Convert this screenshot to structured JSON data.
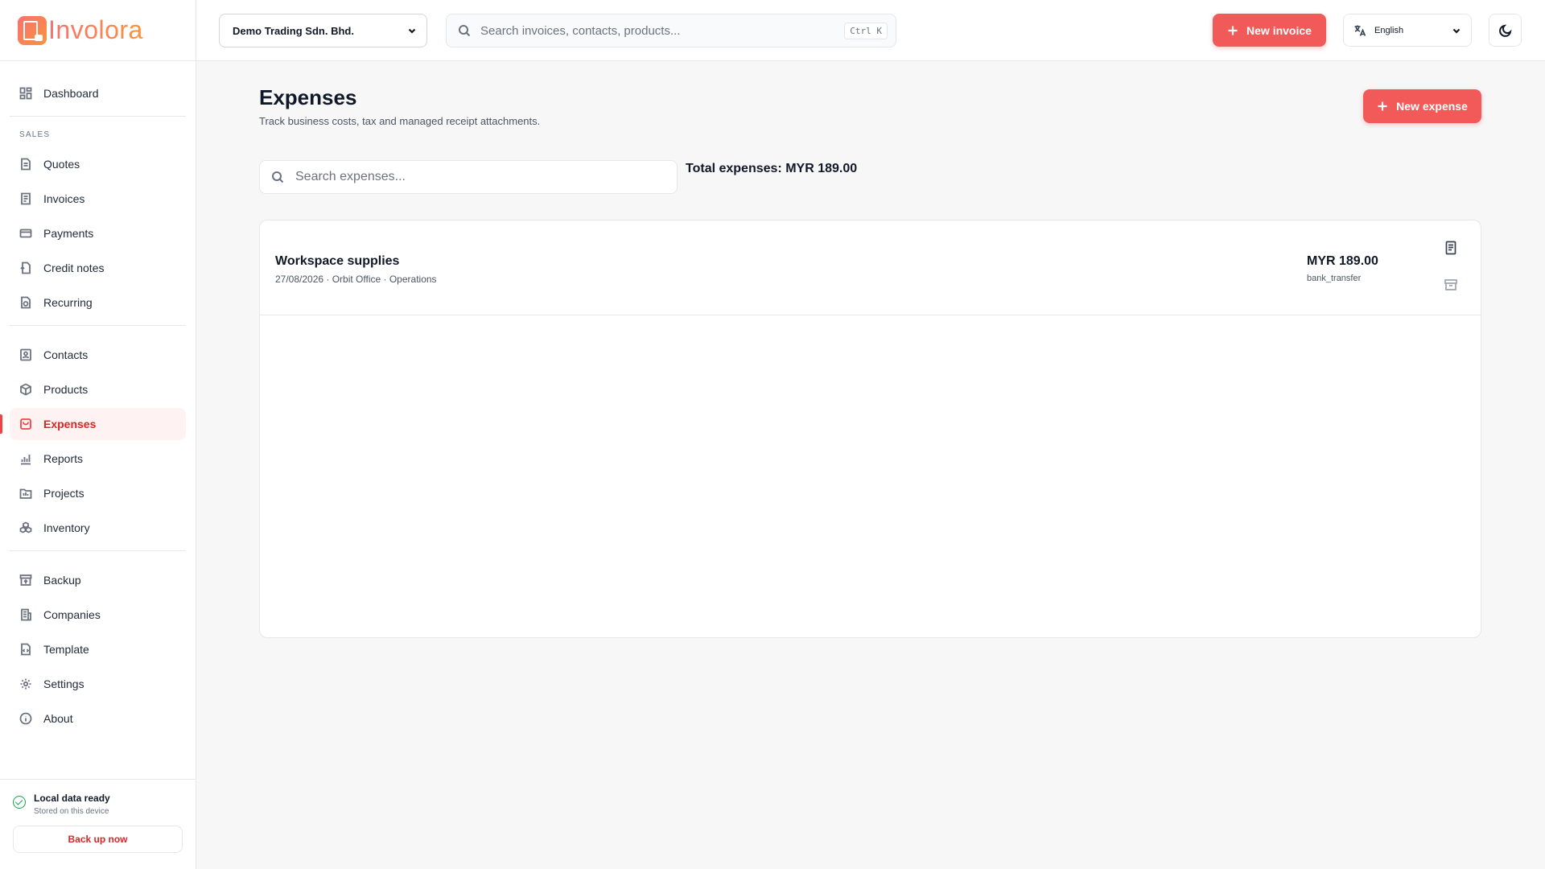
{
  "app": {
    "name": "Involora"
  },
  "header": {
    "company": "Demo Trading Sdn. Bhd.",
    "search_placeholder": "Search invoices, contacts, products...",
    "search_shortcut": "Ctrl K",
    "new_invoice_label": "New invoice",
    "language": "English"
  },
  "sidebar": {
    "dashboard": "Dashboard",
    "section_sales": "SALES",
    "items": {
      "quotes": "Quotes",
      "invoices": "Invoices",
      "payments": "Payments",
      "credit_notes": "Credit notes",
      "recurring": "Recurring",
      "contacts": "Contacts",
      "products": "Products",
      "expenses": "Expenses",
      "reports": "Reports",
      "projects": "Projects",
      "inventory": "Inventory",
      "backup": "Backup",
      "companies": "Companies",
      "template": "Template",
      "settings": "Settings",
      "about": "About"
    },
    "active_item": "Expenses",
    "footer": {
      "status_title": "Local data ready",
      "status_sub": "Stored on this device",
      "backup_label": "Back up now"
    }
  },
  "main": {
    "title": "Expenses",
    "subtitle": "Track business costs, tax and managed receipt attachments.",
    "new_expense_label": "New expense",
    "search_placeholder": "Search expenses...",
    "total_text": "Total expenses: MYR 189.00",
    "expenses": [
      {
        "title": "Workspace supplies",
        "meta": "27/08/2026 · Orbit Office · Operations",
        "amount": "MYR 189.00",
        "method": "bank_transfer"
      }
    ]
  },
  "colors": {
    "accent": "#f25a5a",
    "active_text": "#dc2626",
    "active_bg": "#fef2f2",
    "success": "#16a34a"
  }
}
